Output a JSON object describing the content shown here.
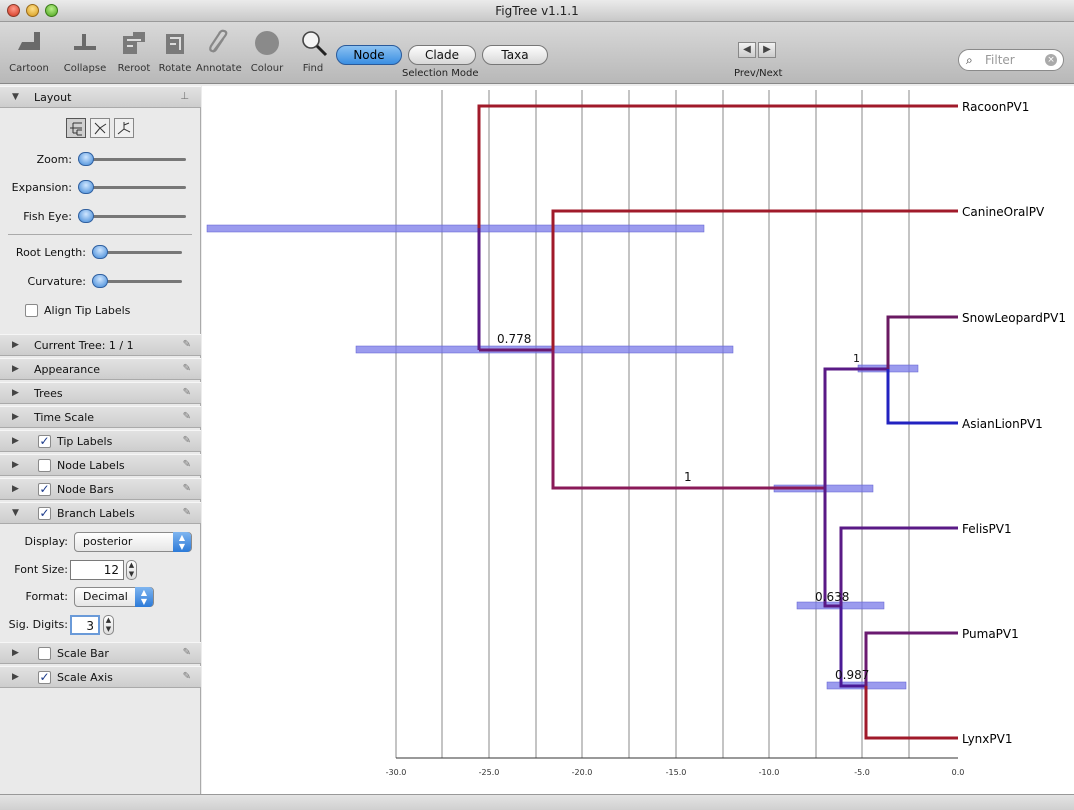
{
  "window": {
    "title": "FigTree v1.1.1"
  },
  "toolbar": {
    "buttons": [
      {
        "label": "Cartoon",
        "icon": "cartoon-icon"
      },
      {
        "label": "Collapse",
        "icon": "collapse-icon"
      },
      {
        "label": "Reroot",
        "icon": "reroot-icon"
      },
      {
        "label": "Rotate",
        "icon": "rotate-icon"
      },
      {
        "label": "Annotate",
        "icon": "paperclip-icon"
      },
      {
        "label": "Colour",
        "icon": "colour-circle-icon"
      },
      {
        "label": "Find",
        "icon": "magnifier-icon"
      }
    ],
    "selection_mode": {
      "options": [
        "Node",
        "Clade",
        "Taxa"
      ],
      "selected": "Node",
      "caption": "Selection Mode"
    },
    "prev_next_caption": "Prev/Next",
    "filter_placeholder": "Filter"
  },
  "sidebar": {
    "layout": {
      "title": "Layout",
      "zoom_label": "Zoom:",
      "expansion_label": "Expansion:",
      "fisheye_label": "Fish Eye:",
      "root_length_label": "Root Length:",
      "curvature_label": "Curvature:",
      "align_tip_labels": "Align Tip Labels"
    },
    "sections": [
      {
        "label": "Current Tree: 1 / 1",
        "checkbox": null
      },
      {
        "label": "Appearance",
        "checkbox": null
      },
      {
        "label": "Trees",
        "checkbox": null
      },
      {
        "label": "Time Scale",
        "checkbox": null
      },
      {
        "label": "Tip Labels",
        "checkbox": true
      },
      {
        "label": "Node Labels",
        "checkbox": false
      },
      {
        "label": "Node Bars",
        "checkbox": true
      },
      {
        "label": "Branch Labels",
        "checkbox": true
      }
    ],
    "branch_labels": {
      "display_label": "Display:",
      "display_value": "posterior",
      "font_size_label": "Font Size:",
      "font_size_value": "12",
      "format_label": "Format:",
      "format_value": "Decimal",
      "sig_digits_label": "Sig. Digits:",
      "sig_digits_value": "3"
    },
    "bottom_sections": [
      {
        "label": "Scale Bar",
        "checkbox": false
      },
      {
        "label": "Scale Axis",
        "checkbox": true
      }
    ]
  },
  "tree": {
    "axis_ticks": [
      "-30.0",
      "-25.0",
      "-20.0",
      "-15.0",
      "-10.0",
      "-5.0",
      "0.0"
    ],
    "tips": [
      "RacoonPV1",
      "CanineOralPV",
      "SnowLeopardPV1",
      "AsianLionPV1",
      "FelisPV1",
      "PumaPV1",
      "LynxPV1"
    ],
    "branch_labels": [
      "0.778",
      "1",
      "1",
      "0.638",
      "0.987"
    ],
    "colors": {
      "red": "#a01a2a",
      "purple": "#5a1a86",
      "blue": "#2222c0",
      "bar": "#7a7ae8"
    }
  }
}
